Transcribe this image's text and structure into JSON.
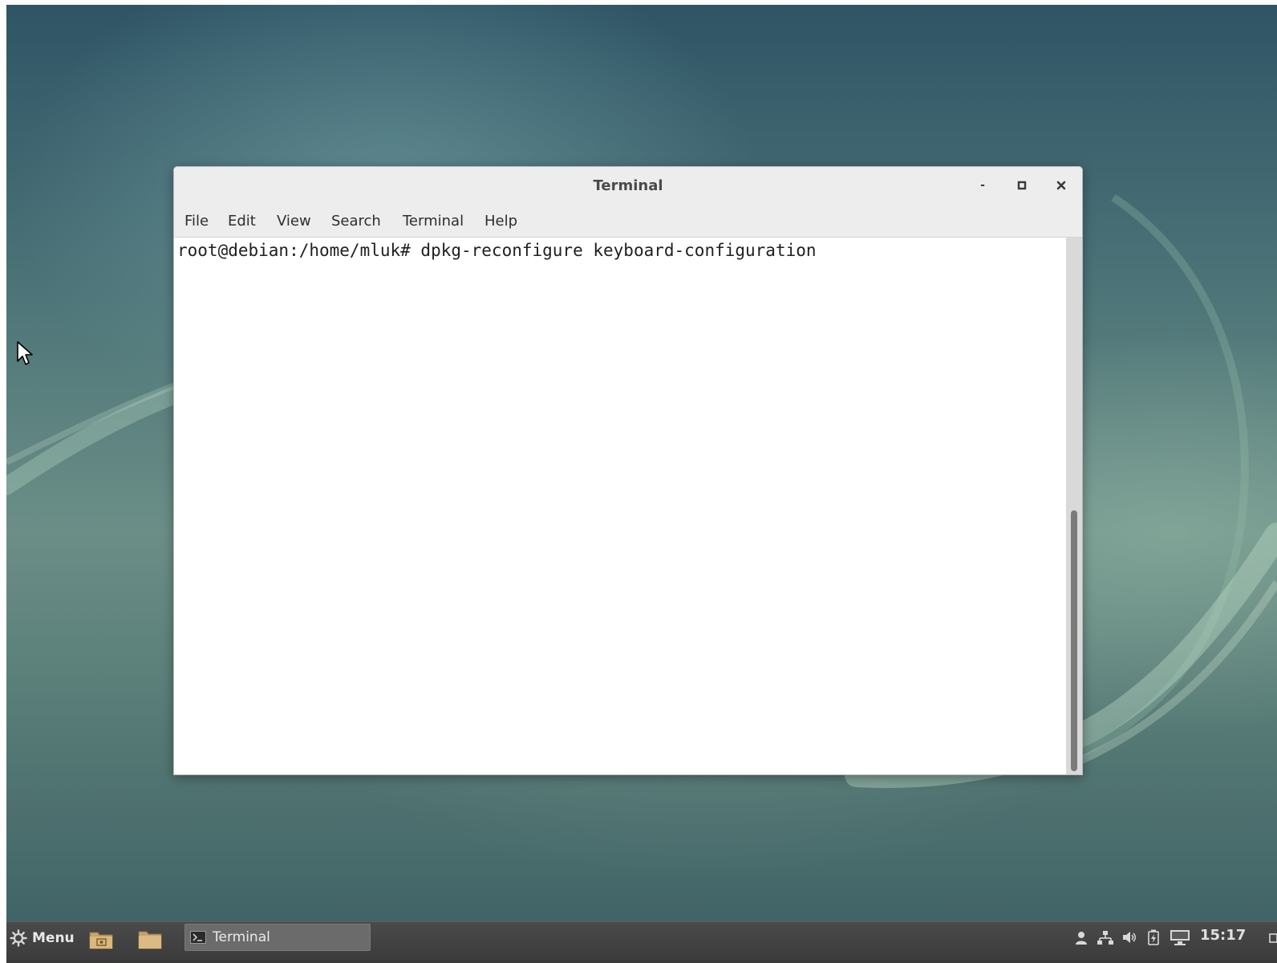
{
  "window": {
    "title": "Terminal",
    "controls": {
      "minimize": "-",
      "maximize": "▫",
      "close": "×"
    },
    "menu": [
      "File",
      "Edit",
      "View",
      "Search",
      "Terminal",
      "Help"
    ]
  },
  "terminal": {
    "lines": [
      "root@debian:/home/mluk# dpkg-reconfigure keyboard-configuration"
    ]
  },
  "taskbar": {
    "menu_label": "Menu",
    "launchers": [
      "photos-folder-icon",
      "folder-icon"
    ],
    "tasks": [
      {
        "label": "Terminal",
        "icon": "terminal-icon",
        "active": true
      }
    ],
    "tray_icons": [
      "user-icon",
      "network-icon",
      "volume-icon",
      "battery-icon",
      "display-icon"
    ],
    "clock": "15:17"
  },
  "colors": {
    "taskbar": "#3f3f3f",
    "titlebar": "#ededed",
    "desktop_top": "#2f5566",
    "desktop_mid": "#6b8f87"
  }
}
